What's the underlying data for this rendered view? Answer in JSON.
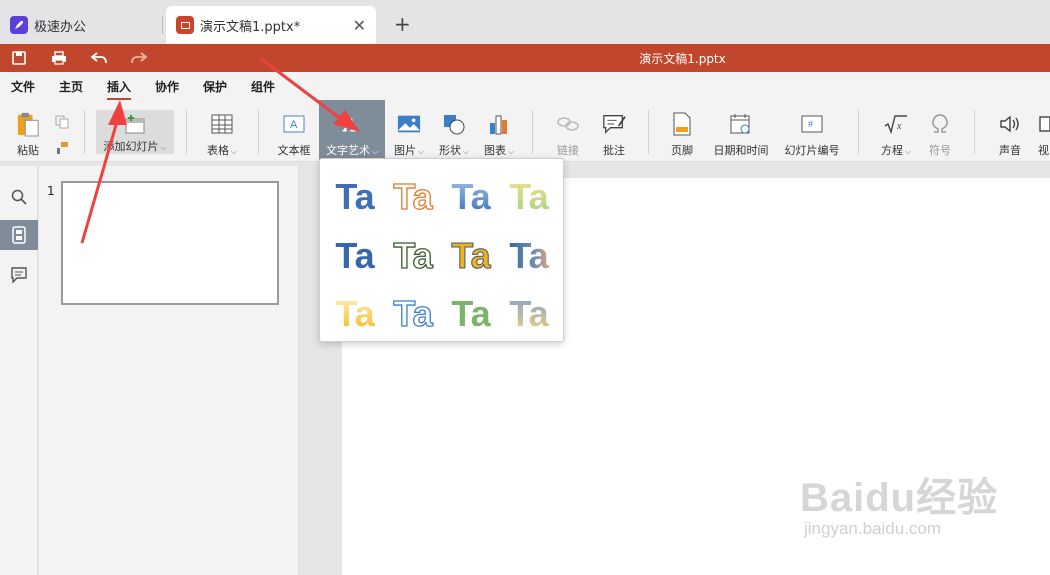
{
  "tabs": {
    "home_label": "极速办公",
    "doc_label": "演示文稿1.pptx*",
    "close_glyph": "✕",
    "new_tab_glyph": "+"
  },
  "titlebar": {
    "title": "演示文稿1.pptx",
    "color": "#c0472c"
  },
  "menu": {
    "items": [
      "文件",
      "主页",
      "插入",
      "协作",
      "保护",
      "组件"
    ],
    "active": "插入",
    "accent": "#c0472c"
  },
  "ribbon": {
    "paste": "粘贴",
    "add_slide": "添加幻灯片",
    "table": "表格",
    "textbox": "文本框",
    "wordart": "文字艺术",
    "picture": "图片",
    "shape": "形状",
    "chart": "图表",
    "link": "链接",
    "comment": "批注",
    "footer": "页脚",
    "datetime": "日期和时间",
    "slide_number": "幻灯片编号",
    "equation": "方程",
    "symbol": "符号",
    "audio": "声音",
    "cut_off": "视"
  },
  "slides_panel": {
    "slide_number": "1"
  },
  "wordart": {
    "sample_text": "Ta",
    "styles": [
      "blue-solid",
      "orange-outline",
      "blue-gradient",
      "yellow-green-fill",
      "blue-bold",
      "dark-green-outline",
      "gold-outline",
      "steel-gradient",
      "yellow-gradient",
      "blue-outline",
      "green-solid",
      "blue-yellow-gradient"
    ]
  },
  "watermark": {
    "logo": "Baidu经验",
    "url": "jingyan.baidu.com"
  }
}
